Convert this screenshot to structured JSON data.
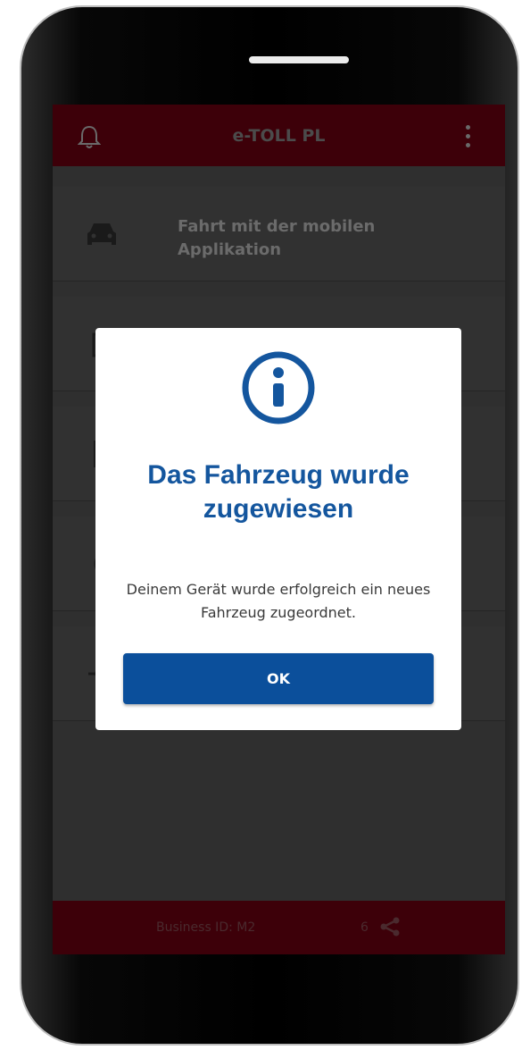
{
  "app": {
    "title": "e-TOLL PL"
  },
  "menu": {
    "items": [
      {
        "label": "Fahrt mit der mobilen Applikation",
        "icon": "car-icon"
      },
      {
        "label": "",
        "icon": "calendar-icon"
      },
      {
        "label": "",
        "icon": "documents-icon"
      },
      {
        "label": "",
        "icon": "circle-icon"
      },
      {
        "label": "",
        "icon": "location-icon"
      }
    ]
  },
  "footer": {
    "business_id": "Business ID:  M2",
    "count": "6"
  },
  "dialog": {
    "icon": "info-icon",
    "title": "Das Fahrzeug wurde zugewiesen",
    "message": "Deinem Gerät wurde erfolgreich ein neues Fahrzeug zugeordnet.",
    "ok_label": "OK"
  },
  "colors": {
    "brand": "#3d0009",
    "accent": "#0b4f9b",
    "title": "#14569e"
  }
}
